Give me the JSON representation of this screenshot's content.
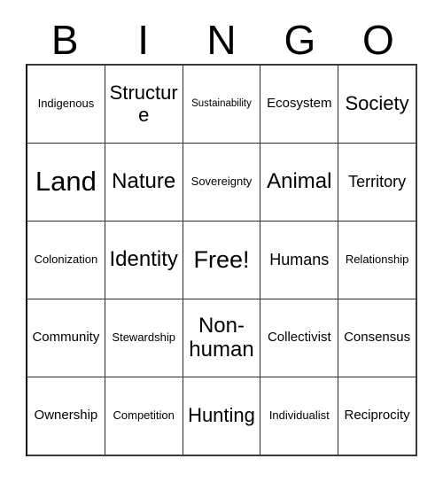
{
  "card": {
    "title": "BINGO",
    "header_letters": [
      "B",
      "I",
      "N",
      "G",
      "O"
    ],
    "free_space_label": "Free!",
    "rows": [
      [
        {
          "label": "Indigenous",
          "size": "fs-s"
        },
        {
          "label": "Structure",
          "size": "fs-xl"
        },
        {
          "label": "Sustainability",
          "size": "fs-xs"
        },
        {
          "label": "Ecosystem",
          "size": "fs-m"
        },
        {
          "label": "Society",
          "size": "fs-xl"
        }
      ],
      [
        {
          "label": "Land",
          "size": "fs-4xl"
        },
        {
          "label": "Nature",
          "size": "fs-xxl"
        },
        {
          "label": "Sovereignty",
          "size": "fs-s"
        },
        {
          "label": "Animal",
          "size": "fs-xxl"
        },
        {
          "label": "Territory",
          "size": "fs-l"
        }
      ],
      [
        {
          "label": "Colonization",
          "size": "fs-s"
        },
        {
          "label": "Identity",
          "size": "fs-xxl"
        },
        {
          "label": "Free!",
          "size": "fs-3xl"
        },
        {
          "label": "Humans",
          "size": "fs-l"
        },
        {
          "label": "Relationship",
          "size": "fs-s"
        }
      ],
      [
        {
          "label": "Community",
          "size": "fs-m"
        },
        {
          "label": "Stewardship",
          "size": "fs-s"
        },
        {
          "label": "Non-human",
          "size": "fs-xxl"
        },
        {
          "label": "Collectivist",
          "size": "fs-m"
        },
        {
          "label": "Consensus",
          "size": "fs-m"
        }
      ],
      [
        {
          "label": "Ownership",
          "size": "fs-m"
        },
        {
          "label": "Competition",
          "size": "fs-s"
        },
        {
          "label": "Hunting",
          "size": "fs-xl"
        },
        {
          "label": "Individualist",
          "size": "fs-s"
        },
        {
          "label": "Reciprocity",
          "size": "fs-m"
        }
      ]
    ]
  },
  "colors": {
    "background": "#ffffff",
    "text": "#000000",
    "grid_line": "#2a2a2a"
  }
}
